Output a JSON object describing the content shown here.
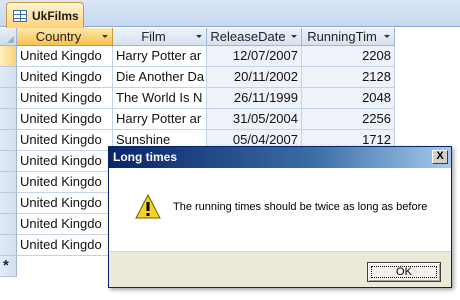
{
  "tab": {
    "label": "UkFilms",
    "icon": "table-icon"
  },
  "columns": [
    {
      "label": "Country"
    },
    {
      "label": "Film"
    },
    {
      "label": "ReleaseDate"
    },
    {
      "label": "RunningTim"
    }
  ],
  "rows": [
    {
      "country": "United Kingdo",
      "film": "Harry Potter ar",
      "release": "12/07/2007",
      "running": "2208"
    },
    {
      "country": "United Kingdo",
      "film": "Die Another Da",
      "release": "20/11/2002",
      "running": "2128"
    },
    {
      "country": "United Kingdo",
      "film": "The World Is N",
      "release": "26/11/1999",
      "running": "2048"
    },
    {
      "country": "United Kingdo",
      "film": "Harry Potter ar",
      "release": "31/05/2004",
      "running": "2256"
    },
    {
      "country": "United Kingdo",
      "film": "Sunshine",
      "release": "05/04/2007",
      "running": "1712"
    },
    {
      "country": "United Kingdo",
      "film": "",
      "release": "",
      "running": ""
    },
    {
      "country": "United Kingdo",
      "film": "",
      "release": "",
      "running": ""
    },
    {
      "country": "United Kingdo",
      "film": "",
      "release": "",
      "running": ""
    },
    {
      "country": "United Kingdo",
      "film": "",
      "release": "",
      "running": ""
    },
    {
      "country": "United Kingdo",
      "film": "",
      "release": "",
      "running": ""
    }
  ],
  "new_row_marker": "*",
  "dialog": {
    "title": "Long times",
    "close_label": "X",
    "icon": "warning-icon",
    "message": "The running times should be twice as long as before",
    "ok_label": "OK"
  }
}
